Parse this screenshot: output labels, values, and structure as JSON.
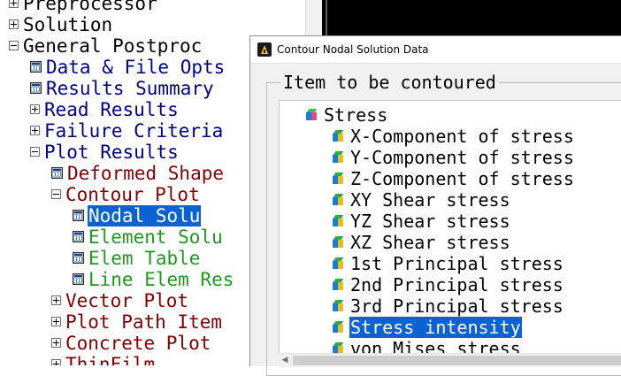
{
  "tree": {
    "items": [
      {
        "label": "Preprocessor",
        "expander": "plus",
        "icon": null,
        "color": "black"
      },
      {
        "label": "Solution",
        "expander": "plus",
        "icon": null,
        "color": "black"
      },
      {
        "label": "General Postproc",
        "expander": "minus",
        "icon": null,
        "color": "black"
      },
      {
        "label": "Data & File Opts",
        "expander": null,
        "icon": "function-icon",
        "color": "navy"
      },
      {
        "label": "Results Summary",
        "expander": null,
        "icon": "function-icon",
        "color": "navy"
      },
      {
        "label": "Read Results",
        "expander": "plus",
        "icon": null,
        "color": "navy"
      },
      {
        "label": "Failure Criteria",
        "expander": "plus",
        "icon": null,
        "color": "navy"
      },
      {
        "label": "Plot Results",
        "expander": "minus",
        "icon": null,
        "color": "navy"
      },
      {
        "label": "Deformed Shape",
        "expander": null,
        "icon": "function-icon",
        "color": "maroon"
      },
      {
        "label": "Contour Plot",
        "expander": "minus",
        "icon": null,
        "color": "maroon"
      },
      {
        "label": "Nodal Solu",
        "expander": null,
        "icon": "function-icon",
        "color": "green",
        "selected": true
      },
      {
        "label": "Element Solu",
        "expander": null,
        "icon": "function-icon",
        "color": "green"
      },
      {
        "label": "Elem Table",
        "expander": null,
        "icon": "function-icon",
        "color": "green"
      },
      {
        "label": "Line Elem Res",
        "expander": null,
        "icon": "function-icon",
        "color": "green"
      },
      {
        "label": "Vector Plot",
        "expander": "plus",
        "icon": null,
        "color": "maroon"
      },
      {
        "label": "Plot Path Item",
        "expander": "plus",
        "icon": null,
        "color": "maroon"
      },
      {
        "label": "Concrete Plot",
        "expander": "plus",
        "icon": null,
        "color": "maroon"
      },
      {
        "label": "ThinFilm",
        "expander": "plus",
        "icon": null,
        "color": "maroon"
      }
    ]
  },
  "dialog": {
    "title": "Contour Nodal Solution Data",
    "group_label": "Item to be contoured",
    "items": [
      {
        "label": "Stress",
        "kind": "folder"
      },
      {
        "label": "X-Component of stress",
        "kind": "item"
      },
      {
        "label": "Y-Component of stress",
        "kind": "item"
      },
      {
        "label": "Z-Component of stress",
        "kind": "item"
      },
      {
        "label": "XY Shear stress",
        "kind": "item"
      },
      {
        "label": "YZ Shear stress",
        "kind": "item"
      },
      {
        "label": "XZ Shear stress",
        "kind": "item"
      },
      {
        "label": "1st Principal stress",
        "kind": "item"
      },
      {
        "label": "2nd Principal stress",
        "kind": "item"
      },
      {
        "label": "3rd Principal stress",
        "kind": "item"
      },
      {
        "label": "Stress intensity",
        "kind": "item",
        "selected": true
      },
      {
        "label": "von Mises stress",
        "kind": "item"
      }
    ]
  },
  "colors": {
    "black": "#000000",
    "navy": "#000080",
    "maroon": "#800000",
    "green": "#1f9a1f",
    "selection": "#0a63d1"
  }
}
